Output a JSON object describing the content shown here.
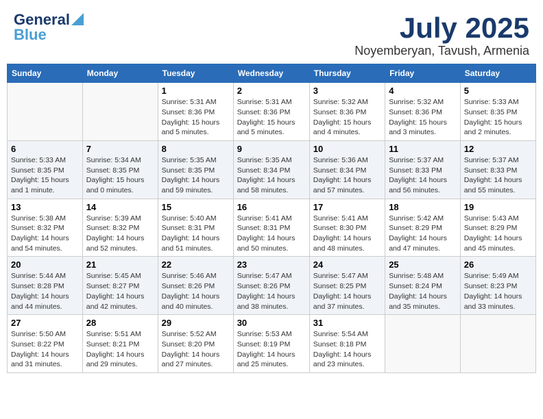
{
  "header": {
    "logo_line1": "General",
    "logo_line2": "Blue",
    "month": "July 2025",
    "location": "Noyemberyan, Tavush, Armenia"
  },
  "weekdays": [
    "Sunday",
    "Monday",
    "Tuesday",
    "Wednesday",
    "Thursday",
    "Friday",
    "Saturday"
  ],
  "weeks": [
    [
      {
        "day": "",
        "info": ""
      },
      {
        "day": "",
        "info": ""
      },
      {
        "day": "1",
        "info": "Sunrise: 5:31 AM\nSunset: 8:36 PM\nDaylight: 15 hours\nand 5 minutes."
      },
      {
        "day": "2",
        "info": "Sunrise: 5:31 AM\nSunset: 8:36 PM\nDaylight: 15 hours\nand 5 minutes."
      },
      {
        "day": "3",
        "info": "Sunrise: 5:32 AM\nSunset: 8:36 PM\nDaylight: 15 hours\nand 4 minutes."
      },
      {
        "day": "4",
        "info": "Sunrise: 5:32 AM\nSunset: 8:36 PM\nDaylight: 15 hours\nand 3 minutes."
      },
      {
        "day": "5",
        "info": "Sunrise: 5:33 AM\nSunset: 8:35 PM\nDaylight: 15 hours\nand 2 minutes."
      }
    ],
    [
      {
        "day": "6",
        "info": "Sunrise: 5:33 AM\nSunset: 8:35 PM\nDaylight: 15 hours\nand 1 minute."
      },
      {
        "day": "7",
        "info": "Sunrise: 5:34 AM\nSunset: 8:35 PM\nDaylight: 15 hours\nand 0 minutes."
      },
      {
        "day": "8",
        "info": "Sunrise: 5:35 AM\nSunset: 8:35 PM\nDaylight: 14 hours\nand 59 minutes."
      },
      {
        "day": "9",
        "info": "Sunrise: 5:35 AM\nSunset: 8:34 PM\nDaylight: 14 hours\nand 58 minutes."
      },
      {
        "day": "10",
        "info": "Sunrise: 5:36 AM\nSunset: 8:34 PM\nDaylight: 14 hours\nand 57 minutes."
      },
      {
        "day": "11",
        "info": "Sunrise: 5:37 AM\nSunset: 8:33 PM\nDaylight: 14 hours\nand 56 minutes."
      },
      {
        "day": "12",
        "info": "Sunrise: 5:37 AM\nSunset: 8:33 PM\nDaylight: 14 hours\nand 55 minutes."
      }
    ],
    [
      {
        "day": "13",
        "info": "Sunrise: 5:38 AM\nSunset: 8:32 PM\nDaylight: 14 hours\nand 54 minutes."
      },
      {
        "day": "14",
        "info": "Sunrise: 5:39 AM\nSunset: 8:32 PM\nDaylight: 14 hours\nand 52 minutes."
      },
      {
        "day": "15",
        "info": "Sunrise: 5:40 AM\nSunset: 8:31 PM\nDaylight: 14 hours\nand 51 minutes."
      },
      {
        "day": "16",
        "info": "Sunrise: 5:41 AM\nSunset: 8:31 PM\nDaylight: 14 hours\nand 50 minutes."
      },
      {
        "day": "17",
        "info": "Sunrise: 5:41 AM\nSunset: 8:30 PM\nDaylight: 14 hours\nand 48 minutes."
      },
      {
        "day": "18",
        "info": "Sunrise: 5:42 AM\nSunset: 8:29 PM\nDaylight: 14 hours\nand 47 minutes."
      },
      {
        "day": "19",
        "info": "Sunrise: 5:43 AM\nSunset: 8:29 PM\nDaylight: 14 hours\nand 45 minutes."
      }
    ],
    [
      {
        "day": "20",
        "info": "Sunrise: 5:44 AM\nSunset: 8:28 PM\nDaylight: 14 hours\nand 44 minutes."
      },
      {
        "day": "21",
        "info": "Sunrise: 5:45 AM\nSunset: 8:27 PM\nDaylight: 14 hours\nand 42 minutes."
      },
      {
        "day": "22",
        "info": "Sunrise: 5:46 AM\nSunset: 8:26 PM\nDaylight: 14 hours\nand 40 minutes."
      },
      {
        "day": "23",
        "info": "Sunrise: 5:47 AM\nSunset: 8:26 PM\nDaylight: 14 hours\nand 38 minutes."
      },
      {
        "day": "24",
        "info": "Sunrise: 5:47 AM\nSunset: 8:25 PM\nDaylight: 14 hours\nand 37 minutes."
      },
      {
        "day": "25",
        "info": "Sunrise: 5:48 AM\nSunset: 8:24 PM\nDaylight: 14 hours\nand 35 minutes."
      },
      {
        "day": "26",
        "info": "Sunrise: 5:49 AM\nSunset: 8:23 PM\nDaylight: 14 hours\nand 33 minutes."
      }
    ],
    [
      {
        "day": "27",
        "info": "Sunrise: 5:50 AM\nSunset: 8:22 PM\nDaylight: 14 hours\nand 31 minutes."
      },
      {
        "day": "28",
        "info": "Sunrise: 5:51 AM\nSunset: 8:21 PM\nDaylight: 14 hours\nand 29 minutes."
      },
      {
        "day": "29",
        "info": "Sunrise: 5:52 AM\nSunset: 8:20 PM\nDaylight: 14 hours\nand 27 minutes."
      },
      {
        "day": "30",
        "info": "Sunrise: 5:53 AM\nSunset: 8:19 PM\nDaylight: 14 hours\nand 25 minutes."
      },
      {
        "day": "31",
        "info": "Sunrise: 5:54 AM\nSunset: 8:18 PM\nDaylight: 14 hours\nand 23 minutes."
      },
      {
        "day": "",
        "info": ""
      },
      {
        "day": "",
        "info": ""
      }
    ]
  ]
}
